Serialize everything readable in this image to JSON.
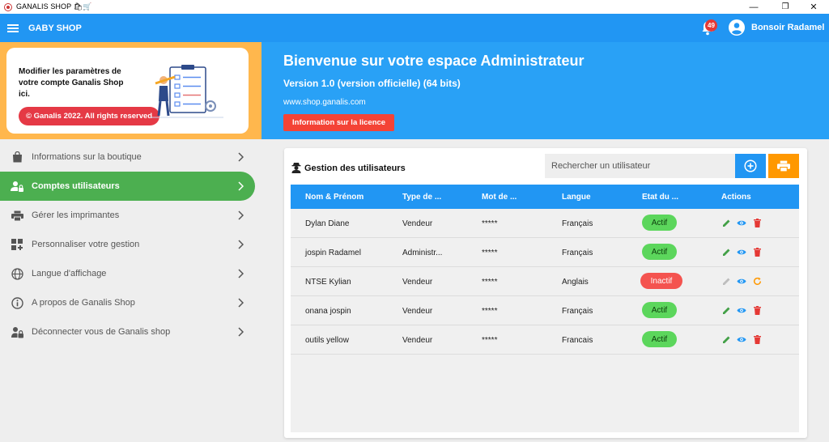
{
  "window": {
    "title": "GANALIS SHOP 🛍🛒",
    "minimize": "—",
    "restore": "❐",
    "close": "✕"
  },
  "appbar": {
    "shop_name": "GABY SHOP",
    "notification_count": "49",
    "greeting": "Bonsoir Radamel"
  },
  "promo": {
    "text": "Modifier les paramètres de votre compte Ganalis Shop ici.",
    "copyright": "© Ganalis 2022. All rights reserved"
  },
  "sidebar": {
    "items": [
      {
        "label": "Informations sur la boutique",
        "icon": "shopping-bag-icon",
        "active": false
      },
      {
        "label": "Comptes utilisateurs",
        "icon": "user-lock-icon",
        "active": true
      },
      {
        "label": "Gérer les imprimantes",
        "icon": "printer-icon",
        "active": false
      },
      {
        "label": "Personnaliser votre gestion",
        "icon": "dashboard-customize-icon",
        "active": false
      },
      {
        "label": "Langue d'affichage",
        "icon": "globe-icon",
        "active": false
      },
      {
        "label": "A propos de Ganalis Shop",
        "icon": "info-icon",
        "active": false
      },
      {
        "label": "Déconnecter vous de Ganalis shop",
        "icon": "lock-icon",
        "active": false
      }
    ]
  },
  "banner": {
    "title": "Bienvenue sur votre espace Administrateur",
    "version": "Version 1.0 (version officielle) (64 bits)",
    "url": "www.shop.ganalis.com",
    "license_button": "Information sur la licence"
  },
  "users": {
    "title": "Gestion des utilisateurs",
    "search_placeholder": "Rechercher un utilisateur",
    "columns": [
      "Nom & Prénom",
      "Type de ...",
      "Mot de ...",
      "Langue",
      "Etat du ...",
      "Actions"
    ],
    "rows": [
      {
        "name": "Dylan Diane",
        "type": "Vendeur",
        "password": "*****",
        "language": "Français",
        "status": "Actif",
        "active": true
      },
      {
        "name": "jospin Radamel",
        "type": "Administr...",
        "password": "*****",
        "language": "Français",
        "status": "Actif",
        "active": true
      },
      {
        "name": "NTSE Kylian",
        "type": "Vendeur",
        "password": "*****",
        "language": "Anglais",
        "status": "Inactif",
        "active": false
      },
      {
        "name": "onana jospin",
        "type": "Vendeur",
        "password": "*****",
        "language": "Français",
        "status": "Actif",
        "active": true
      },
      {
        "name": "outils yellow",
        "type": "Vendeur",
        "password": "*****",
        "language": "Francais",
        "status": "Actif",
        "active": true
      }
    ]
  },
  "colors": {
    "appbar": "#2196f3",
    "banner": "#29a1f6",
    "active_menu": "#4caf50",
    "active_status": "#5cd65c",
    "inactive_status": "#f4534f",
    "add_button": "#2196f3",
    "print_button": "#ff9800",
    "promo_bg": "#ffb74d",
    "danger": "#e53945"
  }
}
